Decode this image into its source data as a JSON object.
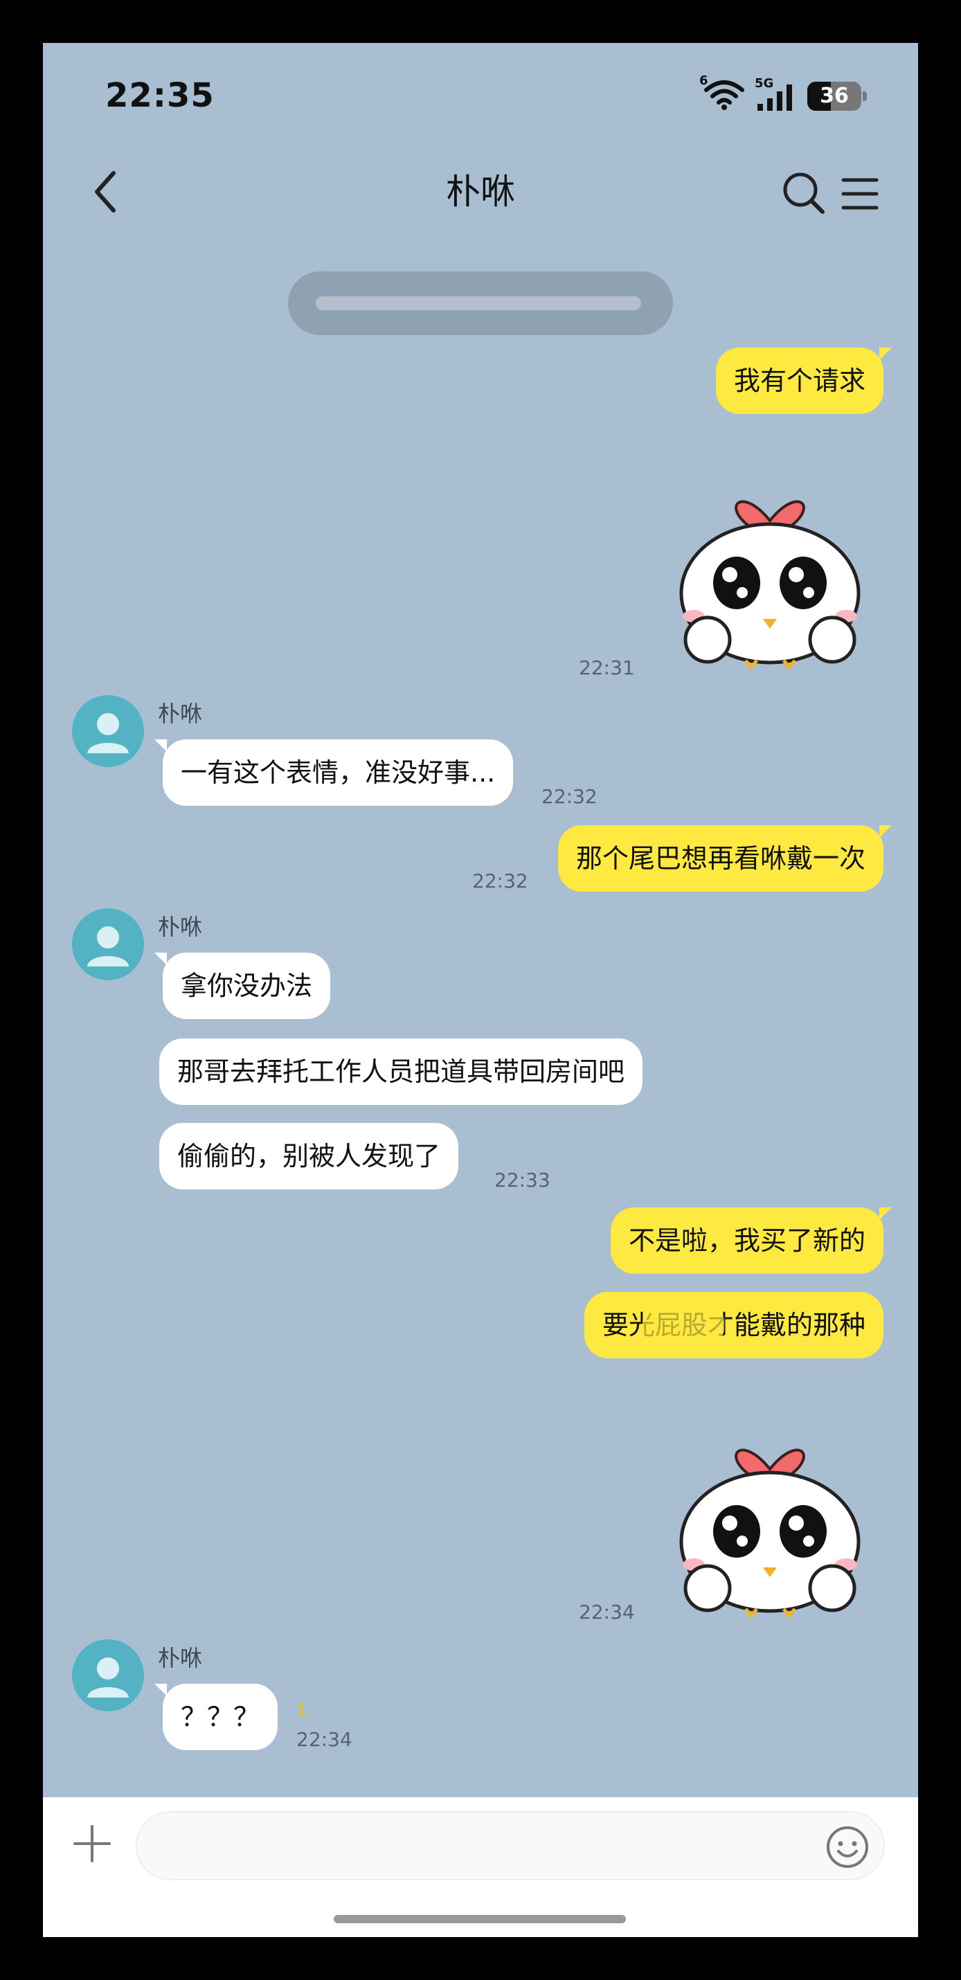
{
  "status_bar": {
    "time": "22:35",
    "battery": "36",
    "network": "5G",
    "wifi_badge": "6"
  },
  "header": {
    "title": "朴咻"
  },
  "system_notice": {
    "text": ""
  },
  "messages": [
    {
      "dir": "out",
      "text": "我有个请求"
    },
    {
      "dir": "out",
      "sticker": "chick-heart-sticker",
      "time": "22:31"
    },
    {
      "dir": "in",
      "sender": "朴咻",
      "text": "一有这个表情，准没好事...",
      "time": "22:32"
    },
    {
      "dir": "out",
      "text": "那个尾巴想再看咻戴一次",
      "time": "22:32"
    },
    {
      "dir": "in",
      "sender": "朴咻",
      "text": "拿你没办法"
    },
    {
      "dir": "in",
      "text": "那哥去拜托工作人员把道具带回房间吧"
    },
    {
      "dir": "in",
      "text": "偷偷的，别被人发现了",
      "time": "22:33"
    },
    {
      "dir": "out",
      "text": "不是啦，我买了新的"
    },
    {
      "dir": "out",
      "text": "要光屁股才能戴的那种"
    },
    {
      "dir": "out",
      "sticker": "chick-heart-sticker",
      "time": "22:34"
    },
    {
      "dir": "in",
      "sender": "朴咻",
      "text": "？？？",
      "time": "22:34",
      "unread": "1"
    }
  ],
  "input": {
    "placeholder": ""
  },
  "colors": {
    "background": "#a9bfd1",
    "outgoing_bubble": "#fde93f",
    "incoming_bubble": "#ffffff",
    "avatar": "#54b3c3"
  },
  "icons": [
    "back-icon",
    "search-icon",
    "menu-icon",
    "plus-icon",
    "emoji-icon",
    "wifi-icon",
    "signal-icon",
    "battery-icon"
  ]
}
